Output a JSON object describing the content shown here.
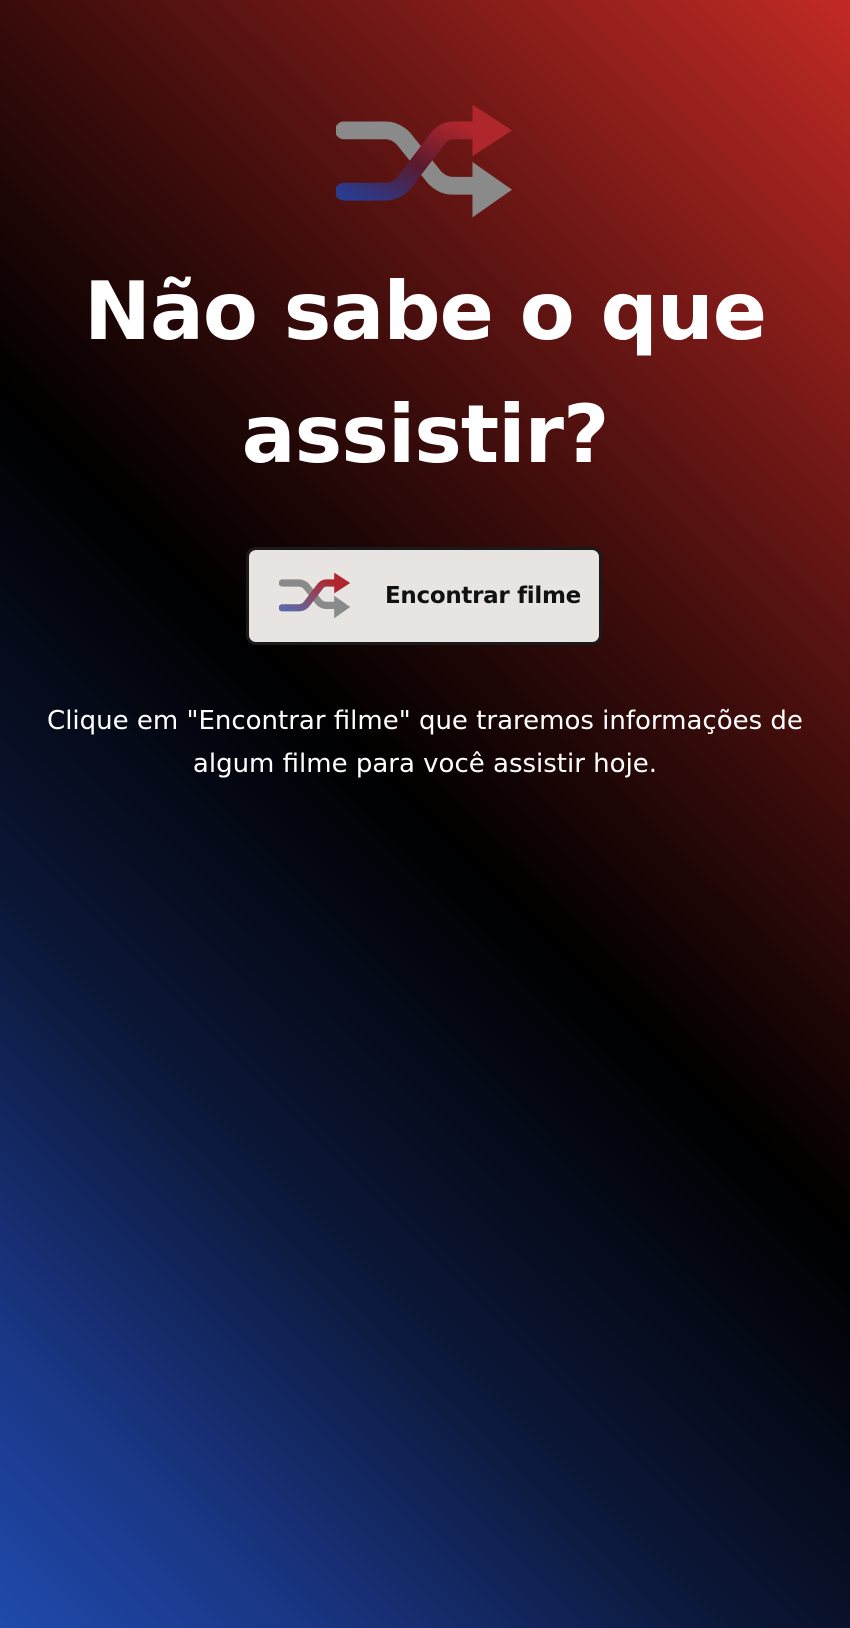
{
  "hero": {
    "icon": "shuffle-icon",
    "title": "Não sabe o que assistir?"
  },
  "find_button": {
    "icon": "shuffle-icon",
    "label": "Encontrar filme"
  },
  "description": "Clique em \"Encontrar filme\" que traremos informações de algum filme para você assistir hoje.",
  "colors": {
    "gradient_top_right": "#c22a24",
    "gradient_middle": "#000000",
    "gradient_bottom_left": "#1f4aab",
    "button_background": "#e8e4e1",
    "icon_red": "#b0262d",
    "icon_blue": "#2a3a8c",
    "icon_gray": "#8a8a8a"
  }
}
